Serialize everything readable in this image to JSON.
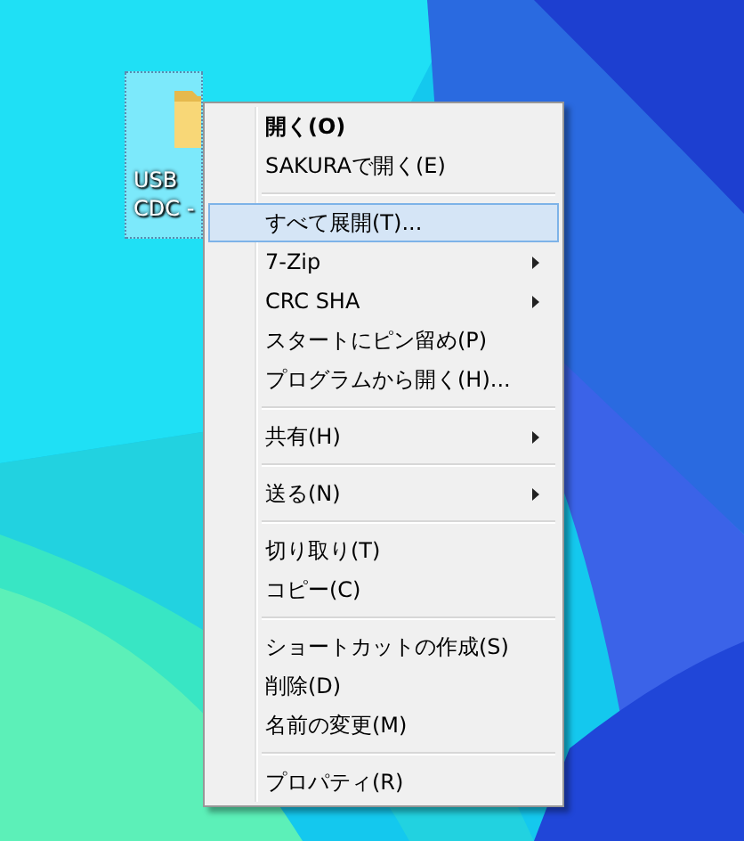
{
  "desktop_icon": {
    "selected": true,
    "label_lines": [
      "USB",
      "CDC -"
    ]
  },
  "context_menu": {
    "items": [
      {
        "kind": "item",
        "label": "開く(O)",
        "default": true,
        "selected": false,
        "submenu": false
      },
      {
        "kind": "item",
        "label": "SAKURAで開く(E)",
        "default": false,
        "selected": false,
        "submenu": false
      },
      {
        "kind": "separator"
      },
      {
        "kind": "item",
        "label": "すべて展開(T)...",
        "default": false,
        "selected": true,
        "submenu": false
      },
      {
        "kind": "item",
        "label": "7-Zip",
        "default": false,
        "selected": false,
        "submenu": true
      },
      {
        "kind": "item",
        "label": "CRC SHA",
        "default": false,
        "selected": false,
        "submenu": true
      },
      {
        "kind": "item",
        "label": "スタートにピン留め(P)",
        "default": false,
        "selected": false,
        "submenu": false
      },
      {
        "kind": "item",
        "label": "プログラムから開く(H)...",
        "default": false,
        "selected": false,
        "submenu": false
      },
      {
        "kind": "separator"
      },
      {
        "kind": "item",
        "label": "共有(H)",
        "default": false,
        "selected": false,
        "submenu": true
      },
      {
        "kind": "separator"
      },
      {
        "kind": "item",
        "label": "送る(N)",
        "default": false,
        "selected": false,
        "submenu": true
      },
      {
        "kind": "separator"
      },
      {
        "kind": "item",
        "label": "切り取り(T)",
        "default": false,
        "selected": false,
        "submenu": false
      },
      {
        "kind": "item",
        "label": "コピー(C)",
        "default": false,
        "selected": false,
        "submenu": false
      },
      {
        "kind": "separator"
      },
      {
        "kind": "item",
        "label": "ショートカットの作成(S)",
        "default": false,
        "selected": false,
        "submenu": false
      },
      {
        "kind": "item",
        "label": "削除(D)",
        "default": false,
        "selected": false,
        "submenu": false
      },
      {
        "kind": "item",
        "label": "名前の変更(M)",
        "default": false,
        "selected": false,
        "submenu": false
      },
      {
        "kind": "separator"
      },
      {
        "kind": "item",
        "label": "プロパティ(R)",
        "default": false,
        "selected": false,
        "submenu": false
      }
    ]
  }
}
